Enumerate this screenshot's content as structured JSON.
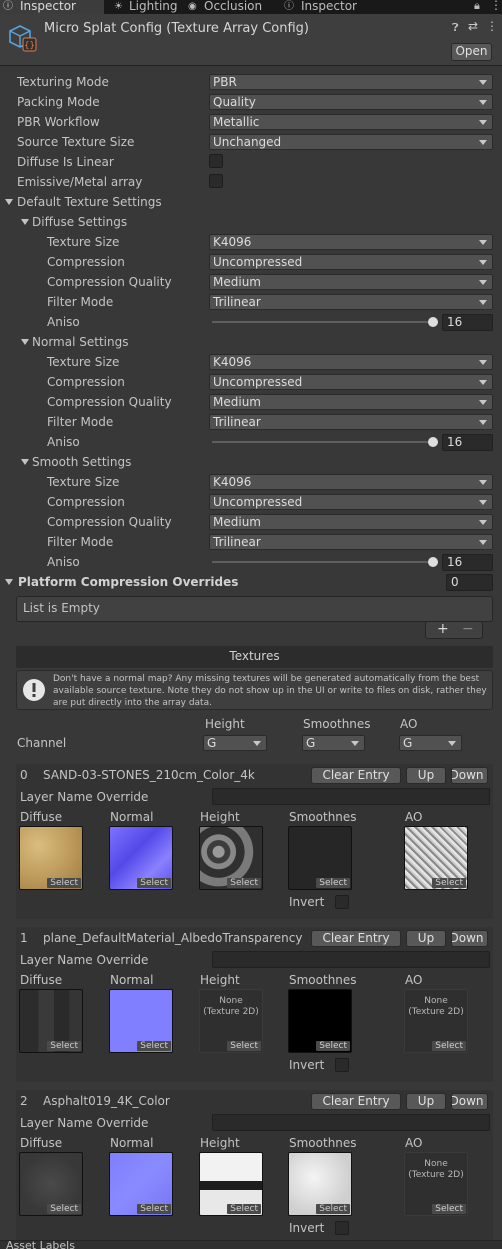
{
  "tabs": [
    {
      "label": "Inspector"
    },
    {
      "label": "Lighting"
    },
    {
      "label": "Occlusion"
    },
    {
      "label": "Inspector"
    }
  ],
  "header": {
    "title": "Micro Splat Config (Texture Array Config)",
    "open_label": "Open"
  },
  "settings": {
    "texturing_mode": {
      "label": "Texturing Mode",
      "value": "PBR"
    },
    "packing_mode": {
      "label": "Packing Mode",
      "value": "Quality"
    },
    "pbr_workflow": {
      "label": "PBR Workflow",
      "value": "Metallic"
    },
    "source_texture_size": {
      "label": "Source Texture Size",
      "value": "Unchanged"
    },
    "diffuse_is_linear": {
      "label": "Diffuse Is Linear",
      "checked": false
    },
    "emissive_metal_array": {
      "label": "Emissive/Metal array",
      "checked": false
    }
  },
  "default_texture_settings": {
    "label": "Default Texture Settings",
    "groups": [
      {
        "label": "Diffuse Settings",
        "texture_size": "K4096",
        "compression": "Uncompressed",
        "quality": "Medium",
        "filter": "Trilinear",
        "aniso": "16"
      },
      {
        "label": "Normal Settings",
        "texture_size": "K4096",
        "compression": "Uncompressed",
        "quality": "Medium",
        "filter": "Trilinear",
        "aniso": "16"
      },
      {
        "label": "Smooth Settings",
        "texture_size": "K4096",
        "compression": "Uncompressed",
        "quality": "Medium",
        "filter": "Trilinear",
        "aniso": "16"
      }
    ],
    "labels": {
      "texture_size": "Texture Size",
      "compression": "Compression",
      "quality": "Compression Quality",
      "filter": "Filter Mode",
      "aniso": "Aniso"
    }
  },
  "platform_overrides": {
    "label": "Platform Compression Overrides",
    "count": "0",
    "empty_text": "List is Empty",
    "add": "+",
    "remove": "−"
  },
  "textures": {
    "title": "Textures",
    "info": "Don't have a normal map? Any missing textures will be generated automatically from the best available source texture. Note they do not show up in the UI or write to files on disk, rather they are put directly into the array data.",
    "channel_label": "Channel",
    "height_label": "Height",
    "smoothness_label": "Smoothnes",
    "ao_label": "AO",
    "height_channel": "G",
    "smoothness_channel": "G",
    "ao_channel": "G",
    "clear_label": "Clear Entry",
    "up_label": "Up",
    "down_label": "Down",
    "layer_override_label": "Layer Name Override",
    "slot_labels": {
      "diffuse": "Diffuse",
      "normal": "Normal",
      "height": "Height",
      "smoothness": "Smoothnes",
      "ao": "AO"
    },
    "select_label": "Select",
    "invert_label": "Invert",
    "none_text": "None (Texture 2D)",
    "entries": [
      {
        "index": "0",
        "name": "SAND-03-STONES_210cm_Color_4k"
      },
      {
        "index": "1",
        "name": "plane_DefaultMaterial_AlbedoTransparency"
      },
      {
        "index": "2",
        "name": "Asphalt019_4K_Color"
      }
    ]
  },
  "footer": {
    "text": "Asset Labels"
  },
  "colors": {
    "accent": "#2c5d87",
    "background": "#383838"
  }
}
